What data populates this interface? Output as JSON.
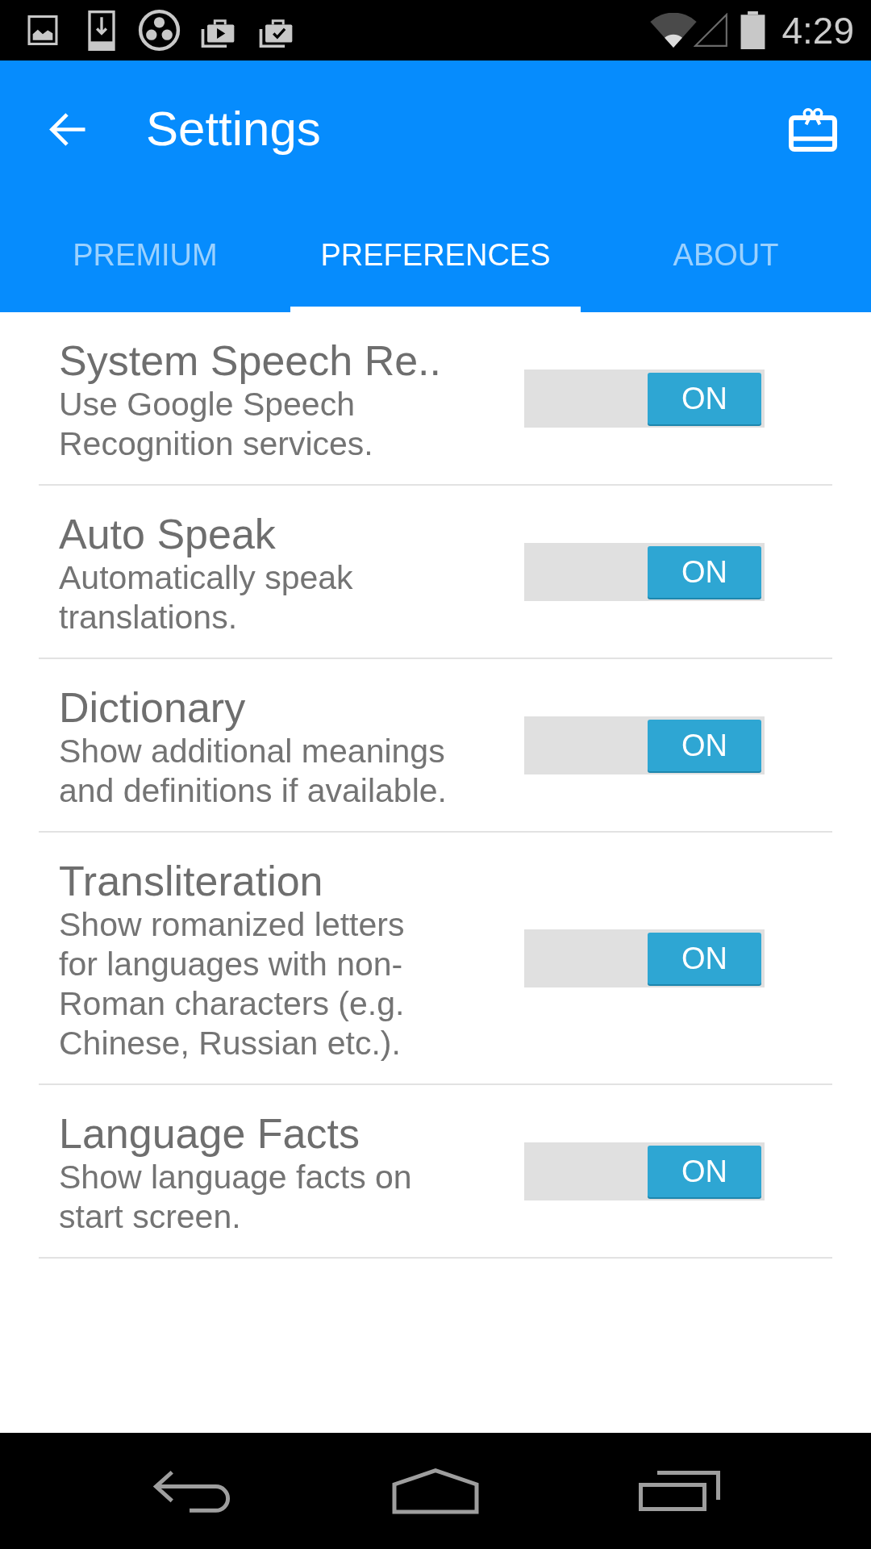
{
  "status_bar": {
    "time": "4:29"
  },
  "app_bar": {
    "title": "Settings"
  },
  "tabs": [
    {
      "label": "PREMIUM",
      "selected": false
    },
    {
      "label": "PREFERENCES",
      "selected": true
    },
    {
      "label": "ABOUT",
      "selected": false
    }
  ],
  "settings": [
    {
      "title": "System Speech Re..",
      "description": "Use Google Speech Recognition services.",
      "switch_label": "ON",
      "on": true
    },
    {
      "title": "Auto Speak",
      "description": "Automatically speak translations.",
      "switch_label": "ON",
      "on": true
    },
    {
      "title": "Dictionary",
      "description": "Show additional meanings and definitions if available.",
      "switch_label": "ON",
      "on": true
    },
    {
      "title": "Transliteration",
      "description": "Show romanized letters for languages with non-Roman characters (e.g. Chinese, Russian etc.).",
      "switch_label": "ON",
      "on": true
    },
    {
      "title": "Language Facts",
      "description": "Show language facts on start screen.",
      "switch_label": "ON",
      "on": true
    }
  ]
}
